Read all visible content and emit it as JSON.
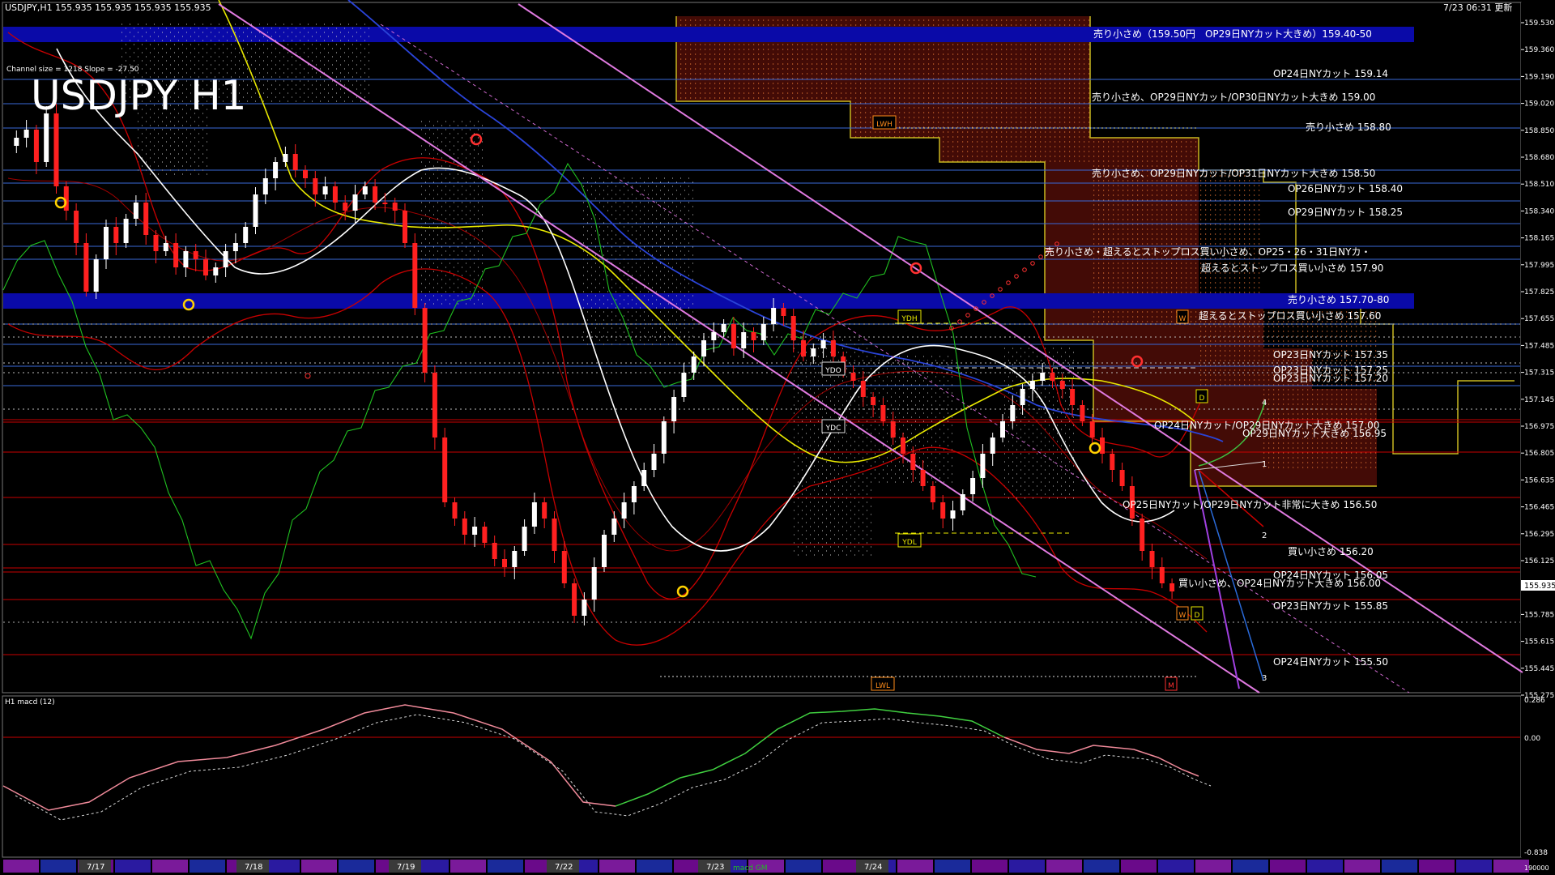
{
  "header": {
    "info": "USDJPY,H1 155.935 155.935 155.935 155.935",
    "time": "7/23 06:31 更新",
    "channel_info": "Channel size = 1218 Slope = -27.50",
    "big_title": "USDJPY H1"
  },
  "indicator": {
    "label": "H1 macd (12)",
    "scale": [
      "0.286",
      "0.00",
      "-0.838"
    ],
    "right_bottom": "190000",
    "macd_text": "macd GM"
  },
  "price_scale": [
    "159.530",
    "159.360",
    "159.190",
    "159.020",
    "158.850",
    "158.680",
    "158.510",
    "158.340",
    "158.165",
    "157.995",
    "157.825",
    "157.655",
    "157.485",
    "157.315",
    "157.145",
    "156.975",
    "156.805",
    "156.635",
    "156.465",
    "156.295",
    "156.125",
    "155.935",
    "155.785",
    "155.615",
    "155.445",
    "155.275"
  ],
  "current_price": "155.935",
  "levels": [
    {
      "text": "売り小さめ（159.50円　OP29日NYカット大きめ）159.40-50",
      "band": true
    },
    {
      "text": "OP24日NYカット 159.14"
    },
    {
      "text": "売り小さめ、OP29日NYカット/OP30日NYカット大きめ 159.00"
    },
    {
      "text": "売り小さめ 158.80"
    },
    {
      "text": "売り小さめ、OP29日NYカット/OP31日NYカット大きめ 158.50"
    },
    {
      "text": "OP26日NYカット 158.40"
    },
    {
      "text": "OP29日NYカット 158.25"
    },
    {
      "text": "売り小さめ・超えるとストップロス買い小さめ、OP25・26・31日NYカ・"
    },
    {
      "text": "超えるとストップロス買い小さめ 157.90"
    },
    {
      "text": "売り小さめ 157.70-80",
      "band": true
    },
    {
      "text": "超えるとストップロス買い小さめ 157.60"
    },
    {
      "text": "OP23日NYカット 157.35"
    },
    {
      "text": "OP23日NYカット 157.25"
    },
    {
      "text": "OP23日NYカット 157.20"
    },
    {
      "text": "OP24日NYカット/OP29日NYカット大きめ 157.00"
    },
    {
      "text": "OP29日NYカット大きめ 156.95"
    },
    {
      "text": "OP25日NYカット/OP29日NYカット非常に大きめ 156.50"
    },
    {
      "text": "買い小さめ 156.20"
    },
    {
      "text": "OP24日NYカット 156.05"
    },
    {
      "text": "買い小さめ、OP24日NYカット大きめ 156.00"
    },
    {
      "text": "OP23日NYカット 155.85"
    },
    {
      "text": "OP24日NYカット 155.50"
    }
  ],
  "markers": {
    "lwh": "LWH",
    "ydh": "YDH",
    "ydo": "YDO",
    "ydc": "YDC",
    "ydl": "YDL",
    "lwl": "LWL",
    "w": "W",
    "d": "D",
    "m": "M",
    "n1": "1",
    "n2": "2",
    "n3": "3",
    "n4": "4"
  },
  "dates": [
    "7/17",
    "7/18",
    "7/19",
    "7/22",
    "7/23",
    "7/24"
  ],
  "colors": {
    "bg": "#000000",
    "band": "#0a0aa8",
    "red_line": "#c80000",
    "blue_line": "#3a6ad8",
    "orange": "#ff8c1a",
    "yellow": "#e8e800",
    "magenta": "#e07ae0",
    "green": "#20c020",
    "macd_green": "#40d040",
    "macd_pink": "#f08a9a"
  }
}
